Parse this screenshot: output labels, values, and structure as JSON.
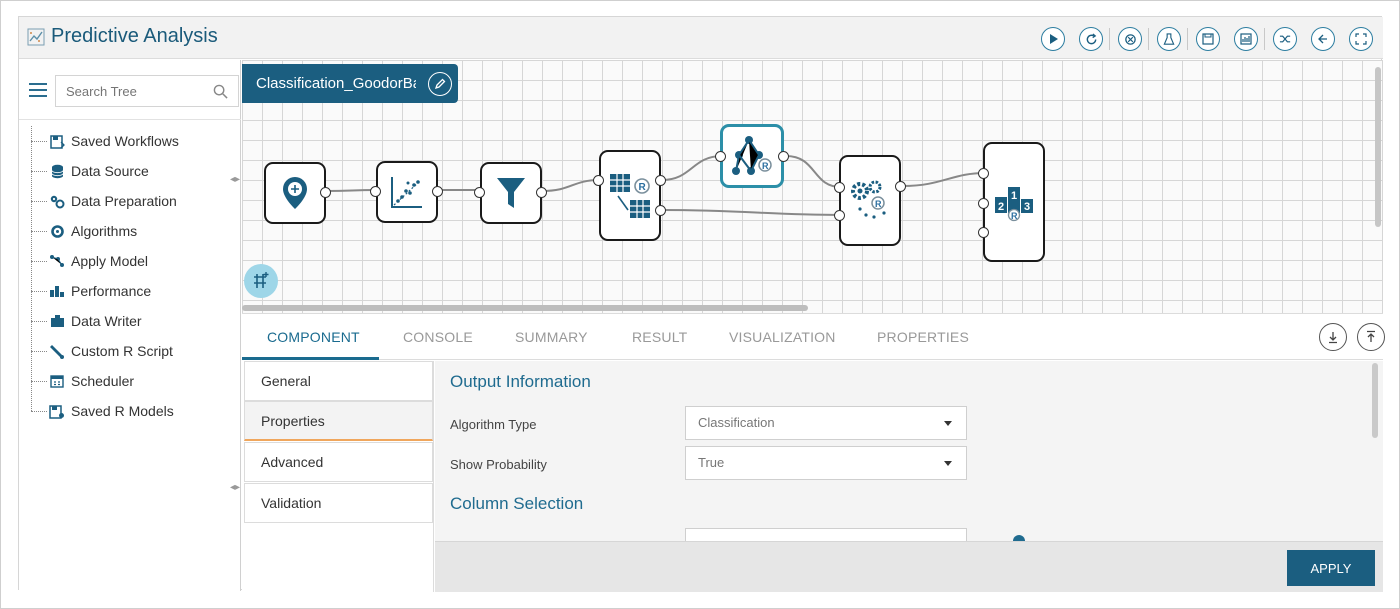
{
  "app": {
    "title": "Predictive Analysis",
    "logo_icon": "chart-logo-icon"
  },
  "toolbar": {
    "buttons": [
      "play-icon",
      "refresh-icon",
      "stop-icon",
      "clear-icon",
      "save-icon",
      "save-as-icon",
      "shuffle-icon",
      "back-icon",
      "fullscreen-icon"
    ]
  },
  "sidebar": {
    "search": {
      "placeholder": "Search Tree"
    },
    "items": [
      {
        "label": "Saved Workflows",
        "icon": "saved-workflows-icon"
      },
      {
        "label": "Data Source",
        "icon": "database-icon"
      },
      {
        "label": "Data Preparation",
        "icon": "data-preparation-icon"
      },
      {
        "label": "Algorithms",
        "icon": "algorithms-icon"
      },
      {
        "label": "Apply Model",
        "icon": "apply-model-icon"
      },
      {
        "label": "Performance",
        "icon": "performance-icon"
      },
      {
        "label": "Data Writer",
        "icon": "data-writer-icon"
      },
      {
        "label": "Custom R Script",
        "icon": "custom-r-script-icon"
      },
      {
        "label": "Scheduler",
        "icon": "scheduler-icon"
      },
      {
        "label": "Saved R Models",
        "icon": "saved-r-models-icon"
      }
    ]
  },
  "workflow": {
    "name": "Classification_GoodorBad"
  },
  "tabs": [
    {
      "label": "COMPONENT",
      "active": true
    },
    {
      "label": "CONSOLE",
      "active": false
    },
    {
      "label": "SUMMARY",
      "active": false
    },
    {
      "label": "RESULT",
      "active": false
    },
    {
      "label": "VISUALIZATION",
      "active": false
    },
    {
      "label": "PROPERTIES",
      "active": false
    }
  ],
  "subnav": [
    {
      "label": "General"
    },
    {
      "label": "Properties"
    },
    {
      "label": "Advanced"
    },
    {
      "label": "Validation"
    }
  ],
  "form": {
    "output_section": "Output Information",
    "algorithm_type_label": "Algorithm Type",
    "algorithm_type_value": "Classification",
    "show_probability_label": "Show Probability",
    "show_probability_value": "True",
    "column_section": "Column Selection"
  },
  "footer": {
    "apply_label": "APPLY"
  },
  "colors": {
    "accent": "#1b5e80",
    "highlight": "#2c8fa8",
    "active_tab_border": "#f0a65c"
  }
}
